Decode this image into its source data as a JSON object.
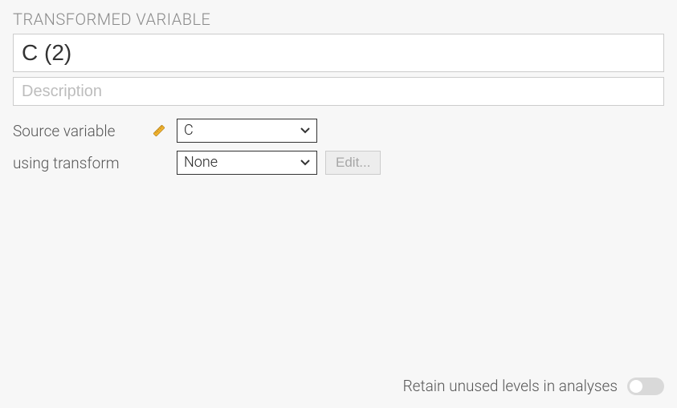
{
  "section_title": "TRANSFORMED VARIABLE",
  "name": {
    "value": "C (2)"
  },
  "description": {
    "placeholder": "Description",
    "value": ""
  },
  "rows": {
    "source": {
      "label": "Source variable",
      "selected": "C"
    },
    "transform": {
      "label": "using transform",
      "selected": "None",
      "edit_label": "Edit..."
    }
  },
  "footer": {
    "retain_label": "Retain unused levels in analyses",
    "retain_on": false
  }
}
